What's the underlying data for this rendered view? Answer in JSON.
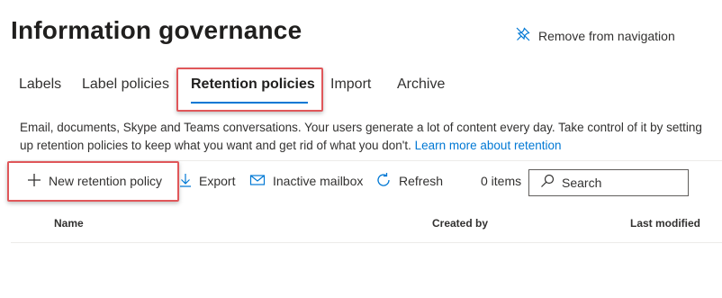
{
  "page": {
    "title": "Information governance",
    "remove_nav_label": "Remove from navigation"
  },
  "tabs": [
    {
      "label": "Labels",
      "active": false
    },
    {
      "label": "Label policies",
      "active": false
    },
    {
      "label": "Retention policies",
      "active": true
    },
    {
      "label": "Import",
      "active": false
    },
    {
      "label": "Archive",
      "active": false
    }
  ],
  "description": {
    "text": "Email, documents, Skype and Teams conversations. Your users generate a lot of content every day. Take control of it by setting up retention policies to keep what you want and get rid of what you don't.",
    "link": "Learn more about retention"
  },
  "toolbar": {
    "new_policy_label": "New retention policy",
    "export_label": "Export",
    "inactive_mailbox_label": "Inactive mailbox",
    "refresh_label": "Refresh",
    "items_count": "0 items",
    "search_placeholder": "Search"
  },
  "table": {
    "columns": [
      "Name",
      "Created by",
      "Last modified"
    ]
  },
  "colors": {
    "accent": "#0078d4",
    "highlight": "#e0575a",
    "text": "#323130"
  },
  "icons": {
    "remove_nav": "pin-off-icon",
    "new_policy": "plus-icon",
    "export": "download-arrow-icon",
    "inactive_mailbox": "mail-icon",
    "refresh": "refresh-icon",
    "search": "search-icon"
  }
}
